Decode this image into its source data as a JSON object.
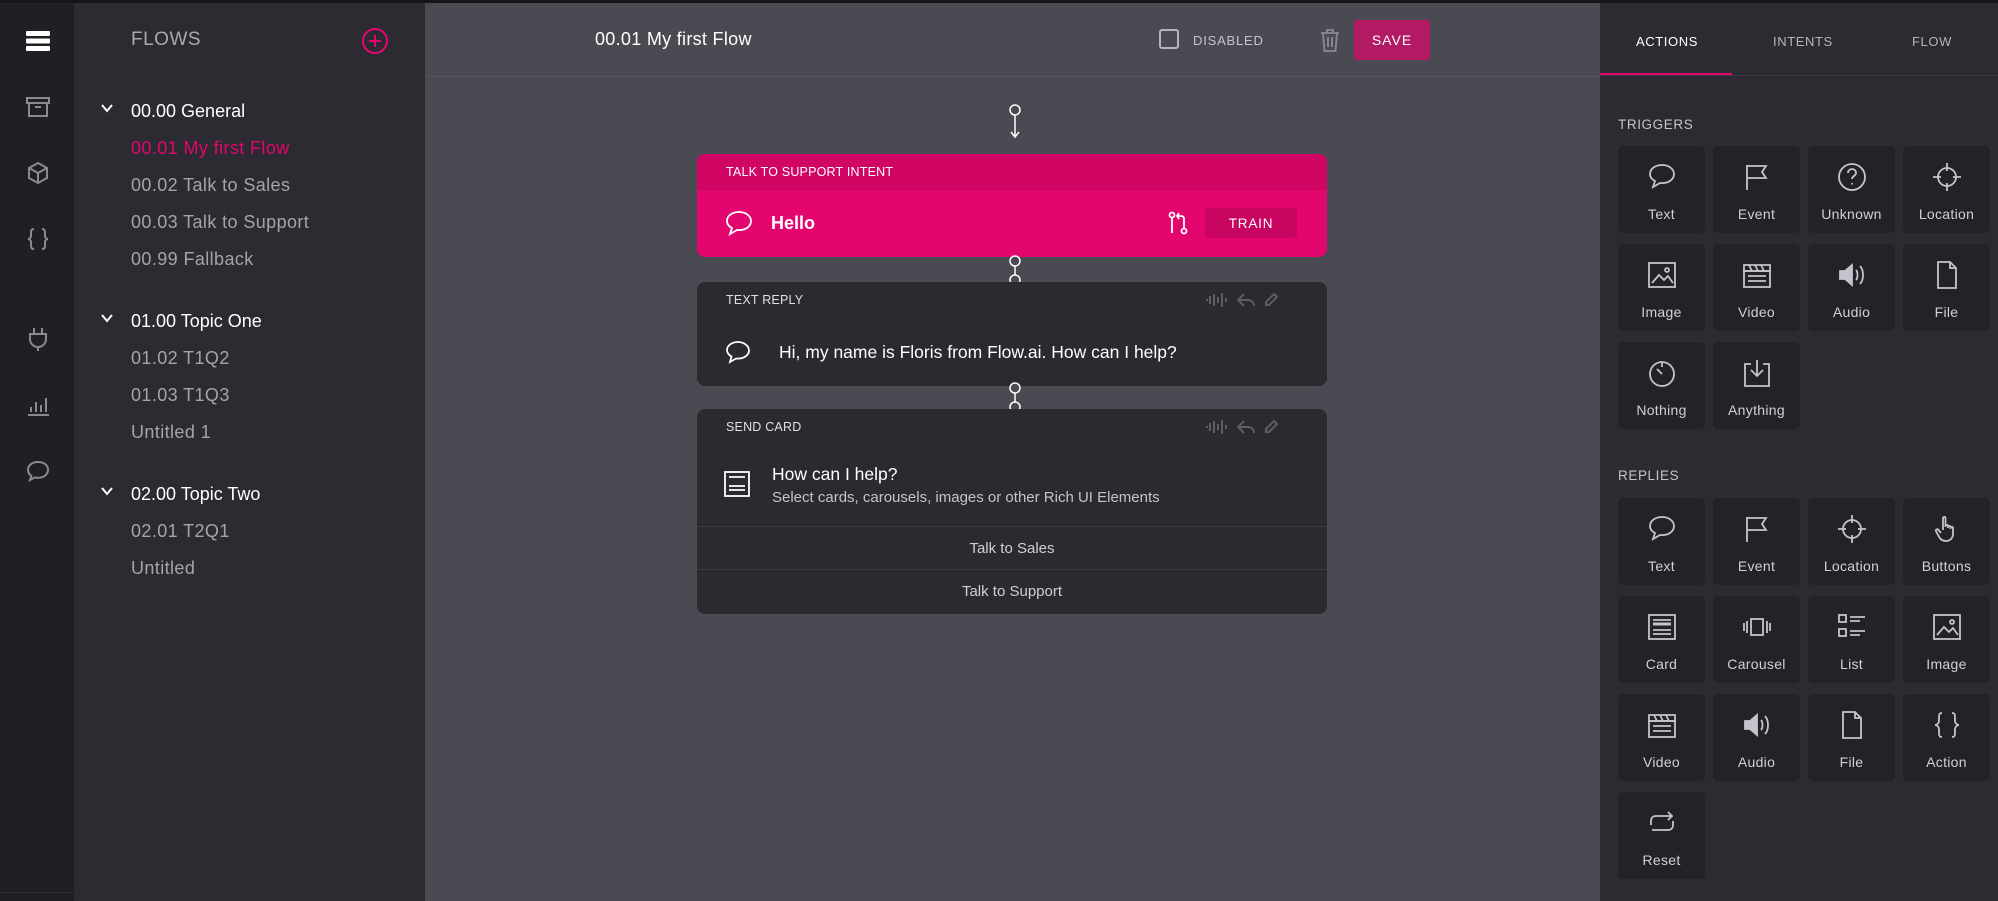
{
  "sidebar": {
    "title": "FLOWS",
    "groups": [
      {
        "name": "00.00 General",
        "items": [
          "00.01 My first Flow",
          "00.02 Talk to Sales",
          "00.03 Talk to Support",
          "00.99 Fallback"
        ]
      },
      {
        "name": "01.00 Topic One",
        "items": [
          "01.02 T1Q2",
          "01.03 T1Q3",
          "Untitled 1"
        ]
      },
      {
        "name": "02.00 Topic Two",
        "items": [
          "02.01 T2Q1",
          "Untitled"
        ]
      }
    ]
  },
  "editor": {
    "flow_title": "00.01 My first Flow",
    "disabled_label": "DISABLED",
    "save_label": "SAVE",
    "intent_card": {
      "header": "TALK TO SUPPORT INTENT",
      "text": "Hello",
      "train_label": "TRAIN"
    },
    "reply_card": {
      "header": "TEXT REPLY",
      "text": "Hi, my name is Floris from Flow.ai. How can I help?"
    },
    "send_card": {
      "header": "SEND CARD",
      "title": "How can I help?",
      "subtitle": "Select cards, carousels, images or other Rich UI Elements",
      "buttons": [
        "Talk to Sales",
        "Talk to Support"
      ]
    }
  },
  "panel": {
    "tabs": [
      "ACTIONS",
      "INTENTS",
      "FLOW"
    ],
    "triggers_title": "TRIGGERS",
    "triggers": [
      {
        "label": "Text",
        "icon": "speech-bubble-icon"
      },
      {
        "label": "Event",
        "icon": "flag-icon"
      },
      {
        "label": "Unknown",
        "icon": "question-icon"
      },
      {
        "label": "Location",
        "icon": "crosshair-icon"
      },
      {
        "label": "Image",
        "icon": "image-icon"
      },
      {
        "label": "Video",
        "icon": "clapperboard-icon"
      },
      {
        "label": "Audio",
        "icon": "speaker-icon"
      },
      {
        "label": "File",
        "icon": "file-icon"
      },
      {
        "label": "Nothing",
        "icon": "timer-icon"
      },
      {
        "label": "Anything",
        "icon": "download-icon"
      }
    ],
    "replies_title": "REPLIES",
    "replies": [
      {
        "label": "Text",
        "icon": "speech-bubble-icon"
      },
      {
        "label": "Event",
        "icon": "flag-icon"
      },
      {
        "label": "Location",
        "icon": "crosshair-icon"
      },
      {
        "label": "Buttons",
        "icon": "hand-pointer-icon"
      },
      {
        "label": "Card",
        "icon": "card-icon"
      },
      {
        "label": "Carousel",
        "icon": "carousel-icon"
      },
      {
        "label": "List",
        "icon": "list-icon"
      },
      {
        "label": "Image",
        "icon": "image-icon"
      },
      {
        "label": "Video",
        "icon": "clapperboard-icon"
      },
      {
        "label": "Audio",
        "icon": "speaker-icon"
      },
      {
        "label": "File",
        "icon": "file-icon"
      },
      {
        "label": "Action",
        "icon": "braces-icon"
      },
      {
        "label": "Reset",
        "icon": "reset-icon"
      }
    ]
  },
  "colors": {
    "accent": "#e3066f",
    "save_button": "#b21a63",
    "canvas": "#4a4a52",
    "sidebar": "#2b2b31",
    "rail": "#1f1f24"
  }
}
